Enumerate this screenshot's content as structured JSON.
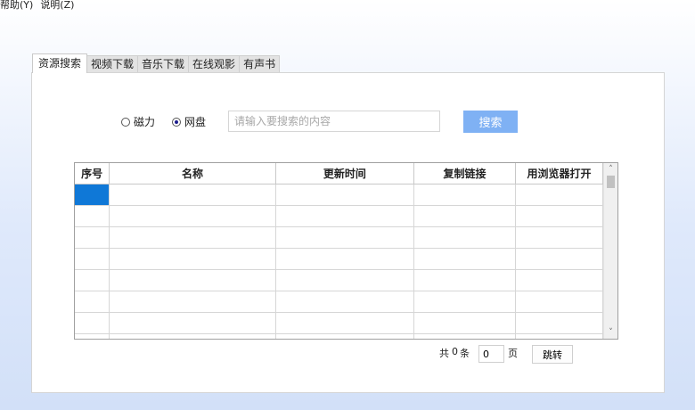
{
  "menu": {
    "items": [
      "帮助(Y)",
      "说明(Z)"
    ]
  },
  "tabs": [
    "资源搜索",
    "视频下载",
    "音乐下载",
    "在线观影",
    "有声书"
  ],
  "search": {
    "radio_magnet": "磁力",
    "radio_netdisk": "网盘",
    "selected": "网盘",
    "placeholder": "请输入要搜索的内容",
    "value": "",
    "button": "搜索"
  },
  "table": {
    "columns": [
      "序号",
      "名称",
      "更新时间",
      "复制链接",
      "用浏览器打开"
    ],
    "rows": []
  },
  "pager": {
    "total_prefix": "共",
    "total_count": "0",
    "total_suffix": "条",
    "page_value": "0",
    "page_unit": "页",
    "jump": "跳转"
  },
  "colors": {
    "accent_button": "#7fb1f4",
    "row_selection": "#0f78d7"
  },
  "icons": {
    "scroll_up": "chevron-up-icon",
    "scroll_down": "chevron-down-icon"
  }
}
